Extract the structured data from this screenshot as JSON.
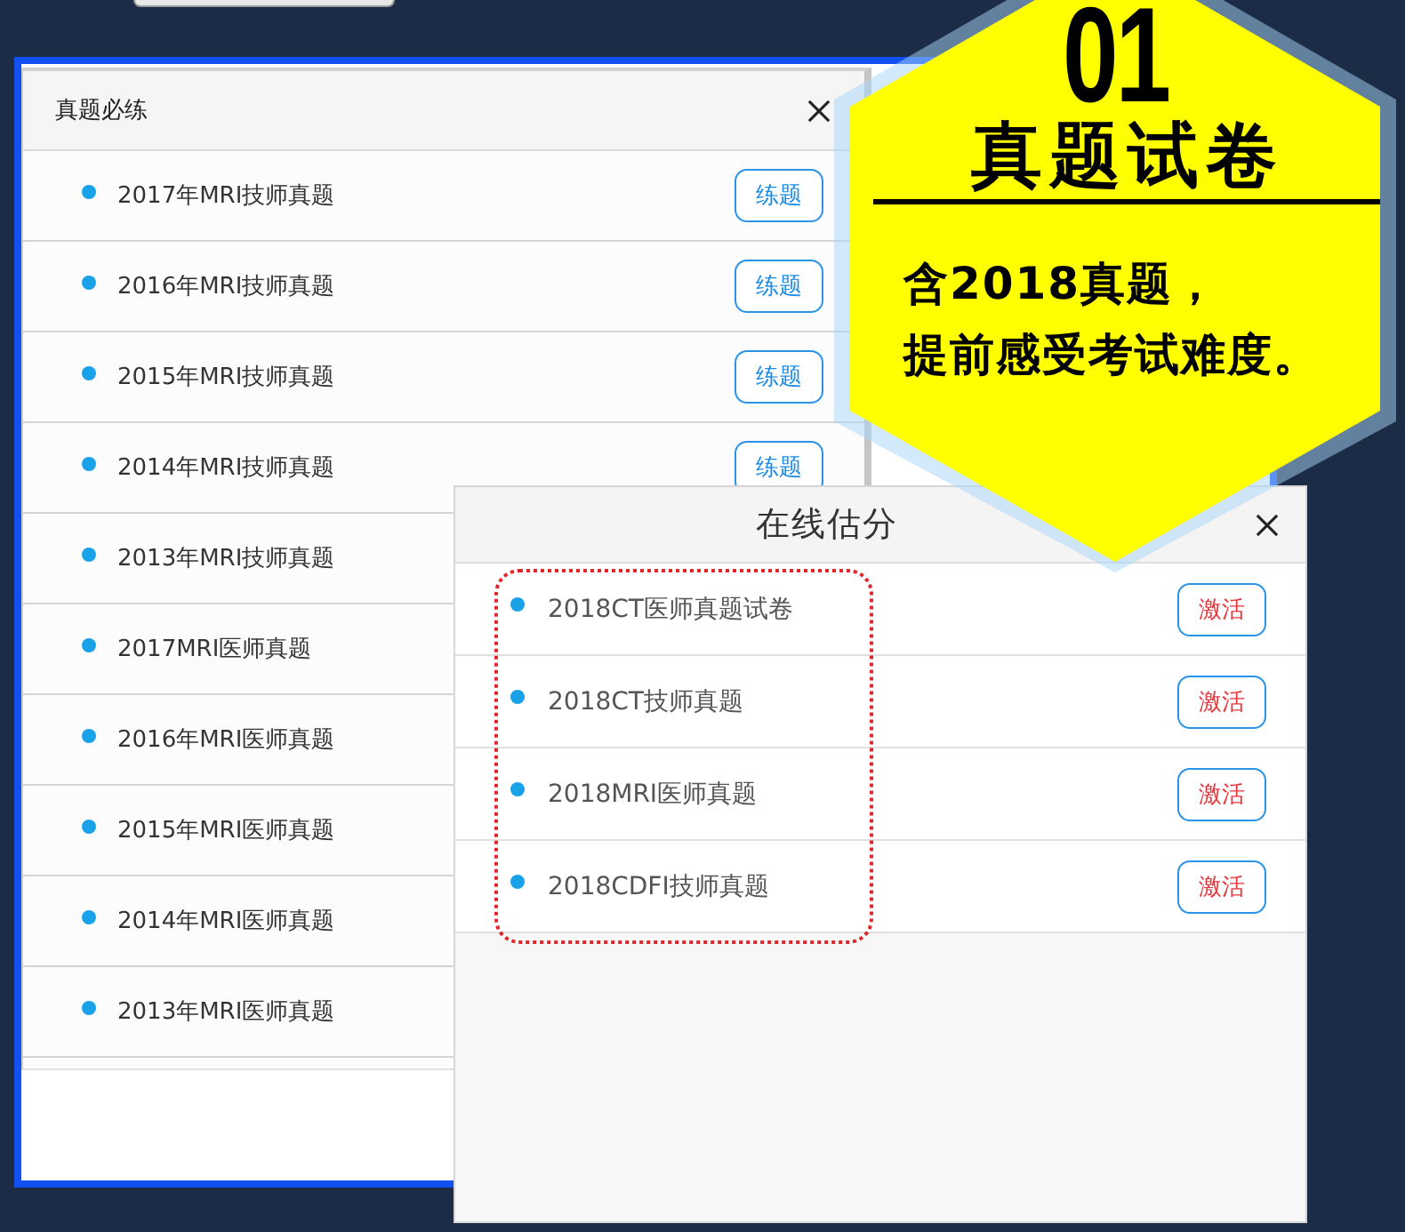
{
  "practice_dialog": {
    "title": "真题必练",
    "items": [
      {
        "label": "2017年MRI技师真题",
        "button": {
          "label": "练题",
          "kind": "practice"
        }
      },
      {
        "label": "2016年MRI技师真题",
        "button": {
          "label": "练题",
          "kind": "practice"
        }
      },
      {
        "label": "2015年MRI技师真题",
        "button": {
          "label": "练题",
          "kind": "practice"
        }
      },
      {
        "label": "2014年MRI技师真题",
        "button": {
          "label": "练题",
          "kind": "practice"
        }
      },
      {
        "label": "2013年MRI技师真题"
      },
      {
        "label": "2017MRI医师真题"
      },
      {
        "label": "2016年MRI医师真题"
      },
      {
        "label": "2015年MRI医师真题"
      },
      {
        "label": "2014年MRI医师真题"
      },
      {
        "label": "2013年MRI医师真题"
      }
    ]
  },
  "estimate_dialog": {
    "title": "在线估分",
    "items_outlined": true,
    "items": [
      {
        "label": "2018CT医师真题试卷",
        "button": {
          "label": "激活",
          "kind": "activate"
        }
      },
      {
        "label": "2018CT技师真题",
        "button": {
          "label": "激活",
          "kind": "activate"
        }
      },
      {
        "label": "2018MRI医师真题",
        "button": {
          "label": "激活",
          "kind": "activate"
        }
      },
      {
        "label": "2018CDFI技师真题",
        "button": {
          "label": "激活",
          "kind": "activate"
        }
      }
    ]
  },
  "badge": {
    "number": "01",
    "title": "真题试卷",
    "description": [
      "含2018真题，",
      "提前感受考试难度。"
    ]
  }
}
